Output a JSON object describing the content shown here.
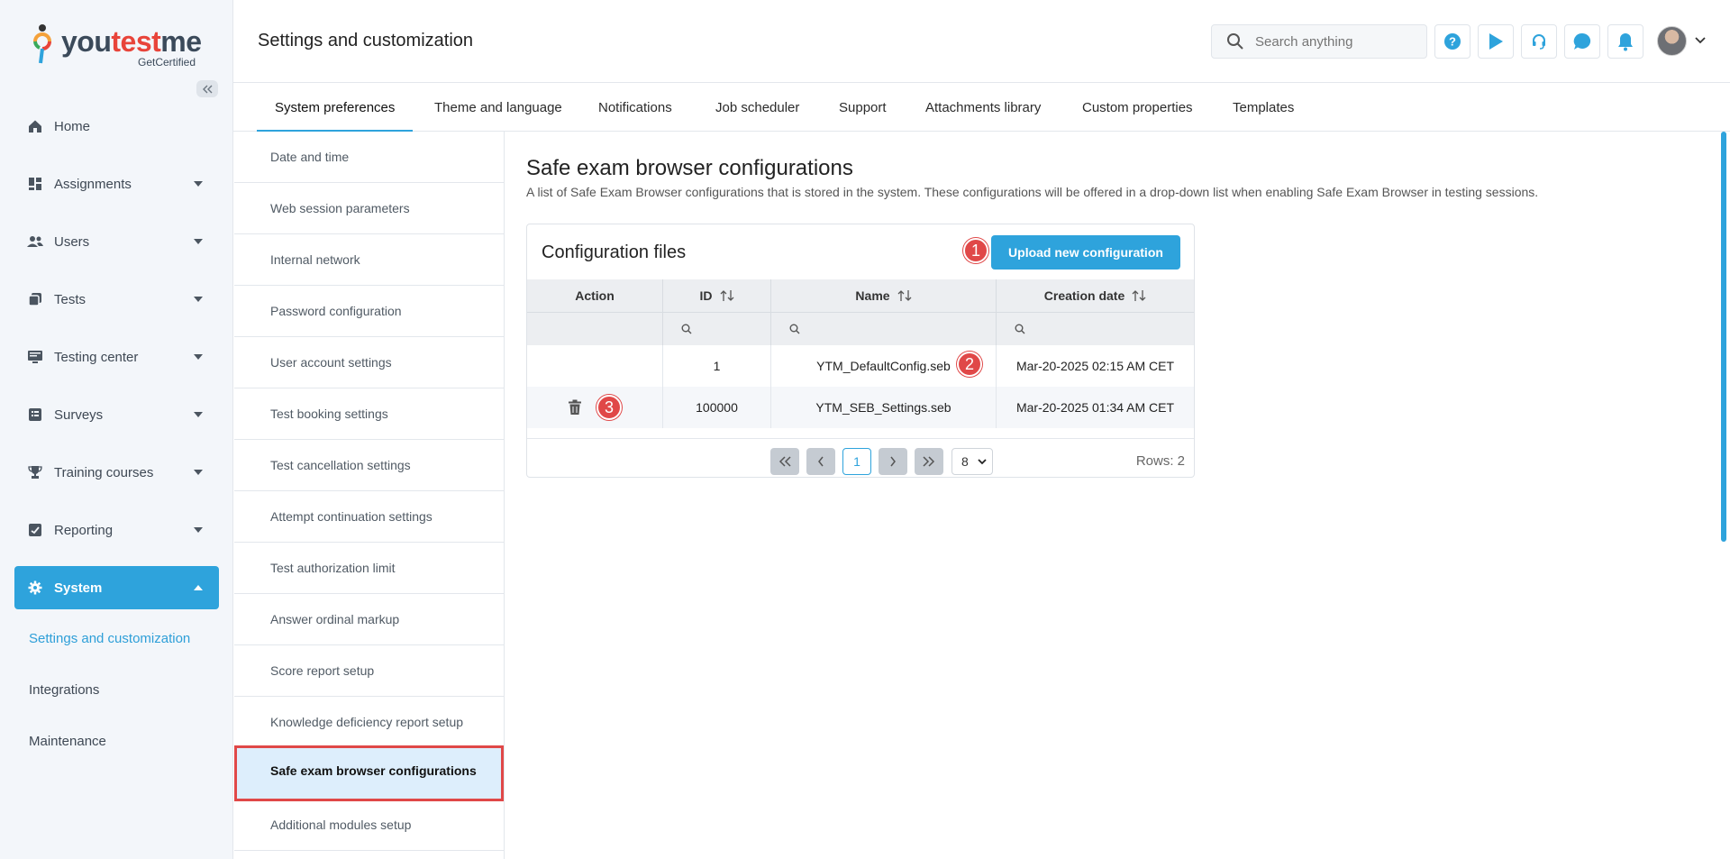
{
  "logo": {
    "word_a": "you",
    "word_b": "test",
    "word_c": "me",
    "sub": "GetCertified"
  },
  "sidebar": {
    "items": [
      {
        "label": "Home",
        "icon": "home-icon"
      },
      {
        "label": "Assignments",
        "icon": "assignments-icon"
      },
      {
        "label": "Users",
        "icon": "users-icon"
      },
      {
        "label": "Tests",
        "icon": "tests-icon"
      },
      {
        "label": "Testing center",
        "icon": "monitor-icon"
      },
      {
        "label": "Surveys",
        "icon": "surveys-icon"
      },
      {
        "label": "Training courses",
        "icon": "trophy-icon"
      },
      {
        "label": "Reporting",
        "icon": "reporting-icon"
      },
      {
        "label": "System",
        "icon": "gear-icon"
      }
    ],
    "subitems": [
      {
        "label": "Settings and customization"
      },
      {
        "label": "Integrations"
      },
      {
        "label": "Maintenance"
      }
    ]
  },
  "header": {
    "title": "Settings and customization",
    "search_placeholder": "Search anything"
  },
  "tabs": [
    {
      "label": "System preferences"
    },
    {
      "label": "Theme and language"
    },
    {
      "label": "Notifications"
    },
    {
      "label": "Job scheduler"
    },
    {
      "label": "Support"
    },
    {
      "label": "Attachments library"
    },
    {
      "label": "Custom properties"
    },
    {
      "label": "Templates"
    }
  ],
  "submenu": [
    {
      "label": "Date and time"
    },
    {
      "label": "Web session parameters"
    },
    {
      "label": "Internal network"
    },
    {
      "label": "Password configuration"
    },
    {
      "label": "User account settings"
    },
    {
      "label": "Test booking settings"
    },
    {
      "label": "Test cancellation settings"
    },
    {
      "label": "Attempt continuation settings"
    },
    {
      "label": "Test authorization limit"
    },
    {
      "label": "Answer ordinal markup"
    },
    {
      "label": "Score report setup"
    },
    {
      "label": "Knowledge deficiency report setup"
    },
    {
      "label": "Safe exam browser configurations"
    },
    {
      "label": "Additional modules setup"
    }
  ],
  "content": {
    "title": "Safe exam browser configurations",
    "description": "A list of Safe Exam Browser configurations that is stored in the system. These configurations will be offered in a drop-down list when enabling Safe Exam Browser in testing sessions.",
    "panel_title": "Configuration files",
    "upload_label": "Upload new configuration",
    "markers": [
      "1",
      "2",
      "3"
    ],
    "columns": [
      "Action",
      "ID",
      "Name",
      "Creation date"
    ],
    "rows": [
      {
        "id": "1",
        "name": "YTM_DefaultConfig.seb",
        "date": "Mar-20-2025 02:15 AM CET"
      },
      {
        "id": "100000",
        "name": "YTM_SEB_Settings.seb",
        "date": "Mar-20-2025 01:34 AM CET"
      }
    ],
    "pager": {
      "page": "1",
      "per_page": "8",
      "rows_text": "Rows: 2"
    }
  },
  "colors": {
    "accent": "#2ea3dc",
    "marker": "#e04848",
    "active_submenu_bg": "#ddeefc"
  }
}
